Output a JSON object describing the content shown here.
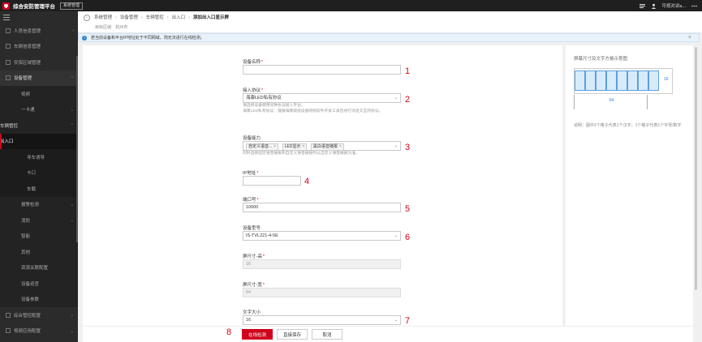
{
  "app": {
    "title": "综合安防管理平台",
    "tag": "系统管理",
    "user": "可视对讲a..."
  },
  "icons": {
    "logo": "shield-logo-icon",
    "menu": "hamburger-icon",
    "list": "list-icon",
    "user": "user-icon",
    "more": "more-icon"
  },
  "sidebar": {
    "items": [
      {
        "label": "人员信息管理",
        "type": "l1",
        "chev": "›"
      },
      {
        "label": "车辆信息管理",
        "type": "l1",
        "chev": ""
      },
      {
        "label": "安保区域管理",
        "type": "l1",
        "chev": ""
      },
      {
        "label": "设备管理",
        "type": "section",
        "chev": "⌃"
      },
      {
        "label": "视频",
        "type": "l2",
        "chev": ""
      },
      {
        "label": "一卡通",
        "type": "l2",
        "chev": "⌄"
      },
      {
        "label": "车辆管控",
        "type": "sub-open",
        "chev": "⌃"
      },
      {
        "label": "出入口",
        "type": "active",
        "chev": ""
      },
      {
        "label": "寻车诱导",
        "type": "l3",
        "chev": ""
      },
      {
        "label": "卡口",
        "type": "l3",
        "chev": ""
      },
      {
        "label": "车载",
        "type": "l3",
        "chev": ""
      },
      {
        "label": "报警检测",
        "type": "l2",
        "chev": "⌄"
      },
      {
        "label": "消防",
        "type": "l2",
        "chev": "⌄"
      },
      {
        "label": "智能",
        "type": "l2",
        "chev": ""
      },
      {
        "label": "其他",
        "type": "l2",
        "chev": ""
      },
      {
        "label": "资源关联配置",
        "type": "l2",
        "chev": ""
      },
      {
        "label": "设备巡查",
        "type": "l2",
        "chev": ""
      },
      {
        "label": "设备参数",
        "type": "l2",
        "chev": ""
      },
      {
        "label": "综合管控配置",
        "type": "l1",
        "chev": "⌄"
      },
      {
        "label": "视频应用配置",
        "type": "l1",
        "chev": "⌄"
      }
    ]
  },
  "header": {
    "crumbs": [
      "系统管理",
      "设备管理",
      "车辆管控",
      "出入口",
      "添加出入口显示屏"
    ],
    "target_label": "目标区域:",
    "target_value": "杭州市"
  },
  "notice": {
    "text": "若当前设备和平台IP地址处于不同网域，则无法进行在线检测。"
  },
  "form": {
    "device_name": {
      "label": "设备名称",
      "value": "",
      "marker": "1"
    },
    "protocol": {
      "label": "接入协议",
      "value": "海康LED私有协议",
      "hint1": "请选择设备使用何种协议接入平台。",
      "hint2": "海康LED私有协议：遵循海康威视设备网络软件开发工具包进行消息交互的协议。",
      "marker": "2"
    },
    "capability": {
      "label": "设备能力",
      "tags": [
        "自定义语音...",
        "LED显示",
        "黑白语音播报"
      ],
      "hint": "同时选择固定语音播报和自定义语音播报时以自定义语音播报为准。",
      "marker": "3"
    },
    "ip": {
      "label": "IP地址",
      "marker": "4"
    },
    "port": {
      "label": "端口号",
      "value": "10000",
      "marker": "5"
    },
    "model": {
      "label": "设备型号",
      "value": "IS-TVL221-4-5E",
      "marker": "6"
    },
    "height": {
      "label": "屏尺寸-高",
      "value": "16"
    },
    "width": {
      "label": "屏尺寸-宽",
      "value": "64"
    },
    "font_size": {
      "label": "文字大小",
      "value": "16",
      "marker": "7"
    }
  },
  "actions": {
    "online_check": "在线检测",
    "save": "直接保存",
    "cancel": "取消",
    "marker": "8"
  },
  "preview": {
    "title": "屏幕尺寸及文字方格示意图",
    "height_label": "16",
    "width_label": "64",
    "desc": "说明：图中2个格子代表1个汉字，1个格子代表1个字母/数字"
  }
}
